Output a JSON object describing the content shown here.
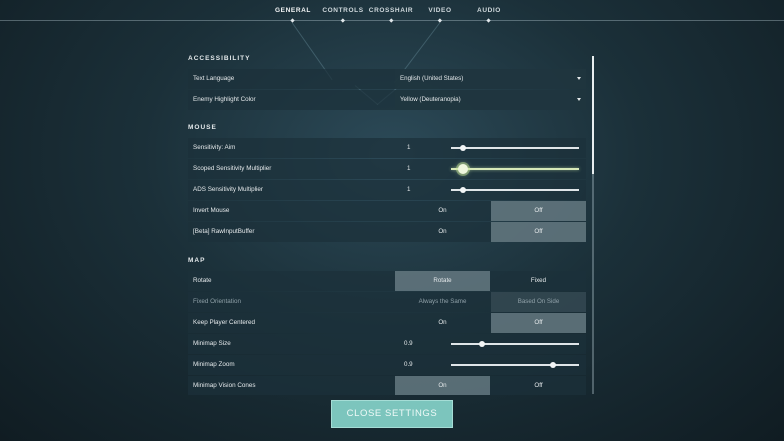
{
  "tabs": [
    {
      "label": "GENERAL",
      "active": true
    },
    {
      "label": "CONTROLS"
    },
    {
      "label": "CROSSHAIR"
    },
    {
      "label": "VIDEO"
    },
    {
      "label": "AUDIO"
    }
  ],
  "accessibility": {
    "title": "ACCESSIBILITY",
    "text_language": {
      "label": "Text Language",
      "value": "English (United States)"
    },
    "enemy_highlight": {
      "label": "Enemy Highlight Color",
      "value": "Yellow (Deuteranopia)"
    }
  },
  "mouse": {
    "title": "MOUSE",
    "aim": {
      "label": "Sensitivity: Aim",
      "value": "1",
      "level": 0.09
    },
    "scoped": {
      "label": "Scoped Sensitivity Multiplier",
      "value": "1",
      "level": 0.09
    },
    "ads": {
      "label": "ADS Sensitivity Multiplier",
      "value": "1",
      "level": 0.09
    },
    "invert": {
      "label": "Invert Mouse",
      "on": "On",
      "off": "Off",
      "selected": "Off"
    },
    "rawinput": {
      "label": "[Beta] RawInputBuffer",
      "on": "On",
      "off": "Off",
      "selected": "Off"
    }
  },
  "map": {
    "title": "MAP",
    "rotate": {
      "label": "Rotate",
      "opt_a": "Rotate",
      "opt_b": "Fixed",
      "selected": "Rotate"
    },
    "fixed_orientation": {
      "label": "Fixed Orientation",
      "opt_a": "Always the Same",
      "opt_b": "Based On Side",
      "selected": "Based On Side",
      "disabled": true
    },
    "keep_centered": {
      "label": "Keep Player Centered",
      "on": "On",
      "off": "Off",
      "selected": "Off"
    },
    "minimap_size": {
      "label": "Minimap Size",
      "value": "0.9",
      "level": 0.24
    },
    "minimap_zoom": {
      "label": "Minimap Zoom",
      "value": "0.9",
      "level": 0.8
    },
    "vision_cones": {
      "label": "Minimap Vision Cones",
      "on": "On",
      "off": "Off",
      "selected": "On"
    }
  },
  "close_button": "CLOSE SETTINGS",
  "colors": {
    "accent": "#7cc5bd",
    "slider_highlight": "#d7e9b9"
  }
}
